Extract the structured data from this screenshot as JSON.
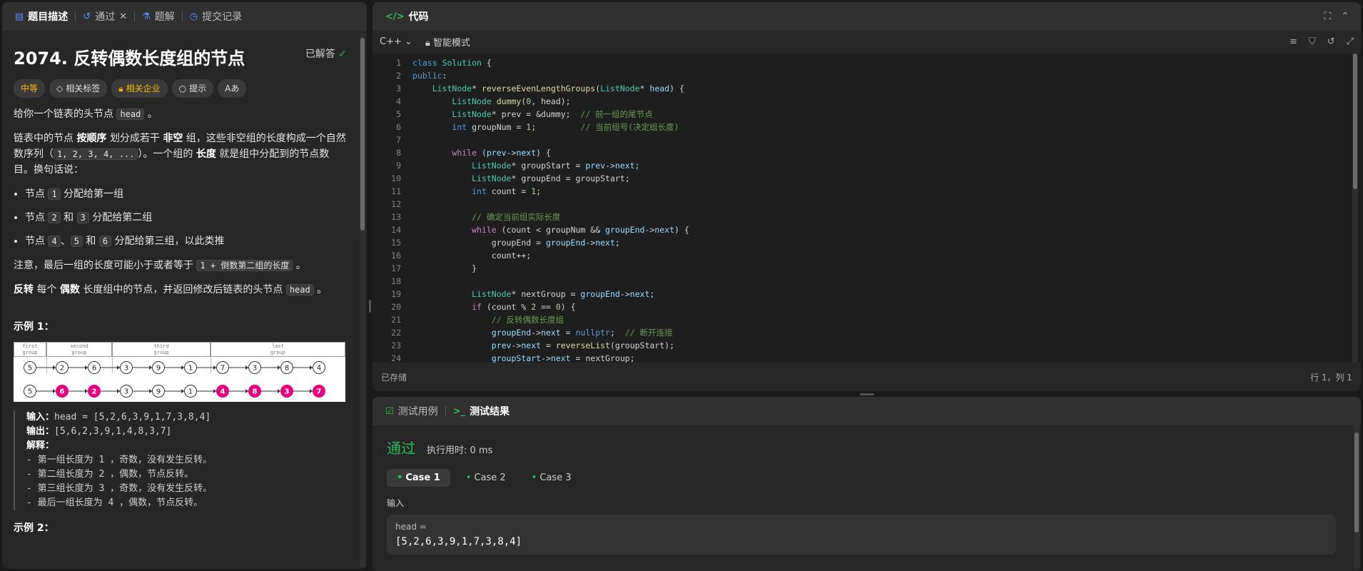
{
  "left_tabs": [
    {
      "icon": "description-icon",
      "label": "题目描述"
    },
    {
      "icon": "history-icon",
      "label": "通过"
    },
    {
      "icon": "flask-icon",
      "label": "题解"
    },
    {
      "icon": "clock-icon",
      "label": "提交记录"
    }
  ],
  "problem": {
    "title": "2074. 反转偶数长度组的节点",
    "solved_label": "已解答",
    "tags": {
      "difficulty": "中等",
      "related_tags": "相关标签",
      "related_companies": "相关企业",
      "hint": "提示",
      "font": "Aあ"
    },
    "p1_pre": "给你一个链表的头节点 ",
    "p1_code": "head",
    "p1_post": " 。",
    "p2_a": "链表中的节点 ",
    "p2_b": "按顺序",
    "p2_c": " 划分成若干 ",
    "p2_d": "非空",
    "p2_e": " 组，这些非空组的长度构成一个自然数序列（",
    "p2_code": "1, 2, 3, 4, ...",
    "p2_f": "）。一个组的 ",
    "p2_g": "长度",
    "p2_h": " 就是组中分配到的节点数目。换句话说：",
    "li1_a": "节点 ",
    "li1_code": "1",
    "li1_b": " 分配给第一组",
    "li2_a": "节点 ",
    "li2_code1": "2",
    "li2_b": " 和 ",
    "li2_code2": "3",
    "li2_c": " 分配给第二组",
    "li3_a": "节点 ",
    "li3_code1": "4",
    "li3_b": "、",
    "li3_code2": "5",
    "li3_c": " 和 ",
    "li3_code3": "6",
    "li3_d": " 分配给第三组，以此类推",
    "p3_a": "注意，最后一组的长度可能小于或者等于 ",
    "p3_code": "1 + 倒数第二组的长度",
    "p3_b": " 。",
    "p4_a": "反转",
    "p4_b": " 每个 ",
    "p4_c": "偶数",
    "p4_d": " 长度组中的节点，并返回修改后链表的头节点 ",
    "p4_code": "head",
    "p4_e": " 。",
    "example1_title": "示例 1：",
    "example1": {
      "input_label": "输入：",
      "input": "head = [5,2,6,3,9,1,7,3,8,4]",
      "output_label": "输出：",
      "output": "[5,6,2,3,9,1,4,8,3,7]",
      "explain_label": "解释：",
      "explain": [
        "- 第一组长度为 1 ，奇数，没有发生反转。",
        "- 第二组长度为 2 ，偶数，节点反转。",
        "- 第三组长度为 3 ，奇数，没有发生反转。",
        "- 最后一组长度为 4 ，偶数，节点反转。"
      ]
    },
    "example2_title": "示例 2：",
    "figure": {
      "groups": [
        "first group",
        "second group",
        "third group",
        "last group"
      ],
      "row1": [
        "5",
        "2",
        "6",
        "3",
        "9",
        "1",
        "7",
        "3",
        "8",
        "4"
      ],
      "row2": [
        "5",
        "6",
        "2",
        "3",
        "9",
        "1",
        "4",
        "8",
        "3",
        "7"
      ]
    }
  },
  "code_panel": {
    "title": "代码",
    "language": "C++",
    "mode": "智能模式",
    "status_left": "已存储",
    "status_right": "行 1，列 1",
    "line_numbers": [
      "1",
      "2",
      "3",
      "4",
      "5",
      "6",
      "7",
      "8",
      "9",
      "10",
      "11",
      "12",
      "13",
      "14",
      "15",
      "16",
      "17",
      "18",
      "19",
      "20",
      "21",
      "22",
      "23",
      "24"
    ]
  },
  "test_panel": {
    "tab_cases": "测试用例",
    "tab_result": "测试结果",
    "result": "通过",
    "runtime": "执行用时: 0 ms",
    "cases": [
      "Case 1",
      "Case 2",
      "Case 3"
    ],
    "input_label": "输入",
    "var_name": "head =",
    "var_value": "[5,2,6,3,9,1,7,3,8,4]"
  },
  "colors": {
    "accent_green": "#2cbb5d",
    "difficulty": "#ffb800",
    "highlight_node": "#e6007e"
  }
}
